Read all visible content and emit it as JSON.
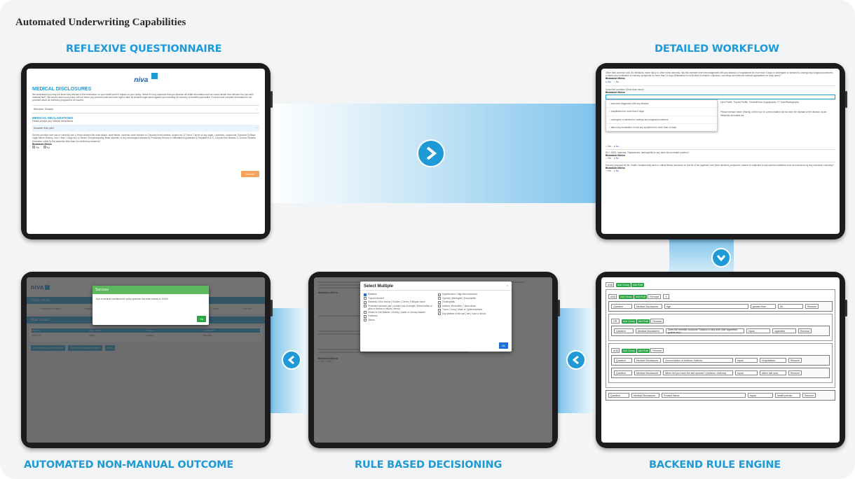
{
  "heading": "Automated Underwriting  Capabilities",
  "captions": {
    "reflexive": "REFLEXIVE QUESTIONNAIRE",
    "workflow": "DETAILED WORKFLOW",
    "outcome": "AUTOMATED NON-MANUAL OUTCOME",
    "decisioning": "RULE BASED DECISIONING",
    "engine": "BACKEND RULE ENGINE"
  },
  "colors": {
    "accent": "#1e9ad6",
    "band": "#7fc4ec",
    "success": "#28a745",
    "submit": "#f4a259"
  },
  "icons": {
    "next": "chevron-right-icon",
    "down": "chevron-down-icon",
    "prev": "chevron-left-icon"
  },
  "screen1": {
    "logo": "niva",
    "title": "MEDICAL DISCLOSURES",
    "intro": "We understand you may not know how relevant is the information on your health and it's impact on your policy. Hence it's very important that you disclose all health information and we would decide how relevant it is (we call it 'material fact'). We would cancel your policy, will not return any premium paid and have right to take all possible legal action against you including for recovery of benefits paid earlier, if correct and complete information is not provided about all members proposed to be insured.",
    "member_details": "Member Details",
    "declarations_title": "MEDICAL DECLARATIONS",
    "declarations_sub": "Please provide your medical declarations",
    "answer_label": "Answer this part",
    "question": "Did this member ever had or currently has 1) Heart disease like heart attack, heart failure, Ischemic heart disease or Coronary heart disease, Angina etc 2) Tumor, Cancer of any organ, Leukemia, Lymphoma, Sarcoma 3) Major organ failure (Kidney, Liver, Heart, Lungs etc) 4) Stroke, Encephalopathy, Brain abscess, or any neurological disease 5) Pulmonary fibrosis or Interstitial lung disease 6) Hepatitis B or C, Chronic liver disease 7) Chronic Disease, Ulcerative colitis 8) Any anaemia other than iron deficiency anaemia?",
    "member": "Bhabatosh Mishra",
    "yes": "Yes",
    "no": "No",
    "submit": "Submit"
  },
  "screen2": {
    "q1": "Other than common cold, flu infections, minor injury or other minor ailments; has this member ever been diagnosed with any disease or hospitalized for more than 5 days or undergone or advised to undergo any surgical procedures or taken any medication or had any symptoms for more than 14 days (Medication is not limited to inhalers, injections, oral drugs and external medical applications on body parts)?",
    "member": "Bhabatosh Mishra",
    "q2": "Select the condition (Other than minor)",
    "dropdown": [
      "was been diagnosed with any disease",
      "hospitalized for more than 5 days",
      "undergone or advised to undergo any surgical procedures",
      "taken any medication or had any symptoms for more than 14 days"
    ],
    "side_text1": "Lipid Profile, Thyroid Profile, Treadmill test, Angiography, CT Scan/Radiography",
    "side_text2": "Please mention name (Family) of their son or current relative did not have the disease of the disease, acute, Metabolic dermatitis etc",
    "q3": "HIV / AIDS, anaemia, Thalassemia, haemophilia or any other blood related problem?",
    "q4": "Has any proposal for life, health, hospital daily cash or critical illness insurance on the life of the applicant ever been declined, postponed, loaded or subjected to any special conditions such as exclusions by any insurance company?",
    "yes": "Yes",
    "no": "No"
  },
  "screen3": {
    "logo": "niva",
    "dialog_title": "Success",
    "dialog_text": "Due to medical conditions the policy premium has been revised to 15000",
    "ok": "Ok",
    "policy_details": "Policy Details",
    "rider_details": "Rider Details",
    "filters": [
      "Policy Status: Issued",
      "Premium: 15000",
      "Sum Insured: 5,00,000",
      "Insured Members",
      "Tenure",
      "Add-ons"
    ],
    "table_headers": [
      "Rider ID",
      "Rider Name",
      "Status",
      "Underwriter"
    ],
    "table_row": [
      "18265120",
      "Opted",
      "Loading",
      "Standard"
    ],
    "buttons": [
      "View Medical Questionnaire",
      "View Underwriting Decision",
      "Back"
    ]
  },
  "screen4": {
    "dialog_title": "Select Multiple",
    "options_left": [
      "Diabetes",
      "Thyroid disorder",
      "Diseases of the Uterus | Ovaries | Cervix | Fallopian tubes",
      "Persistent stomach pain | sudden loss of weight | Bowel habits or piles or fissure or fistula | Hernia",
      "Stones in Gall Bladder | Kidney | Ureter or Urinary bladder",
      "Fractures",
      "Others"
    ],
    "options_right": [
      "Hypertension / High blood pressure",
      "Typhoid | Meningitis | Encephalitis",
      "Cholecystitis",
      "Asthma | Bronchitis | Tuberculosis",
      "Tumor | Lump | Mass or Cysts anywhere",
      "Any disease of the eye | ear | nose or throat"
    ],
    "ok": "Ok",
    "member": "Bhabatosh Mishra",
    "yes": "Yes",
    "no": "No"
  },
  "screen5": {
    "and": "AND",
    "or": "OR",
    "add_group": "Add Group",
    "add_rule": "Add Rule",
    "remove": "Remove",
    "x": "X",
    "rules": [
      {
        "type": "Question",
        "section": "Medical Disclosures",
        "question": "Age",
        "op": "greater than",
        "value": "60"
      },
      {
        "type": "Question",
        "section": "Medical Disclosures",
        "question": "Does the member consume Tobacco in any form (like cigarettes, gutkha etc)?",
        "op": "equal",
        "value": "cigarettes"
      },
      {
        "type": "Question",
        "section": "Medical Disclosures",
        "question": "Current status of Asthma / Asthma",
        "op": "equal",
        "value": "Hospitalised"
      },
      {
        "type": "Question",
        "section": "Medical Disclosures",
        "question": "When did you have the last episode? (Asthma / Asthma)",
        "op": "equal",
        "value": "within last year"
      },
      {
        "type": "Question",
        "section": "Medical Disclosures",
        "question": "Product Name",
        "op": "equal",
        "value": "health premia"
      }
    ]
  }
}
